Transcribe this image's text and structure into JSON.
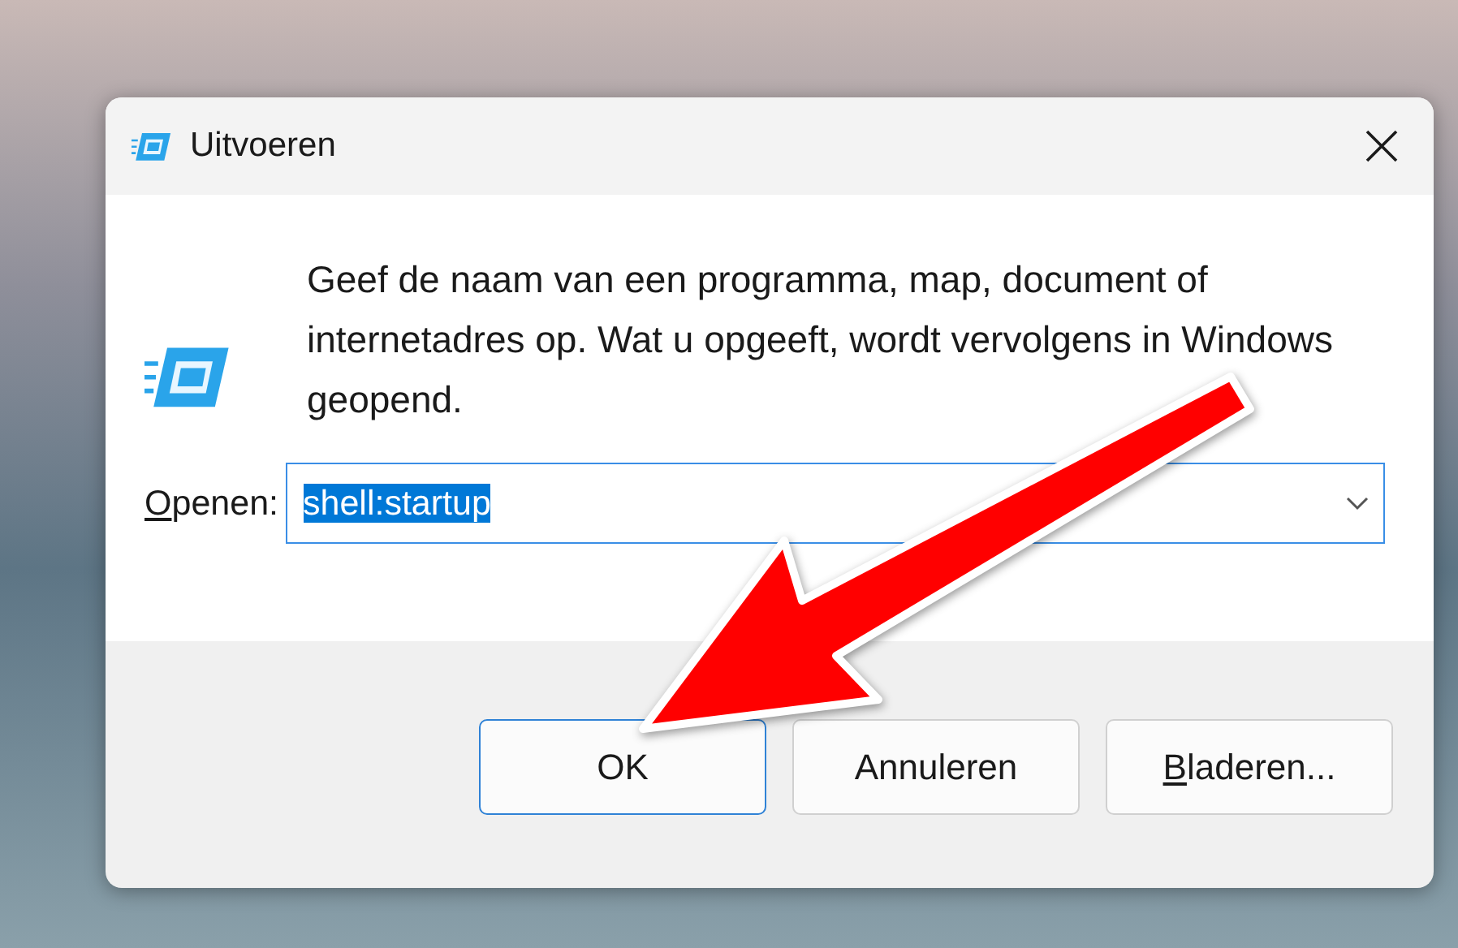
{
  "window": {
    "title": "Uitvoeren"
  },
  "message": "Geef de naam van een programma, map, document of internetadres op. Wat u opgeeft, wordt vervolgens in Windows geopend.",
  "open_field": {
    "label": "Openen:",
    "label_underline_first": true,
    "value": "shell:startup",
    "selected": true
  },
  "buttons": [
    {
      "label": "OK",
      "default": true,
      "underline_first": false
    },
    {
      "label": "Annuleren",
      "default": false,
      "underline_first": false
    },
    {
      "label": "Bladeren...",
      "default": false,
      "underline_first": true
    }
  ],
  "annotation": {
    "kind": "arrow"
  }
}
